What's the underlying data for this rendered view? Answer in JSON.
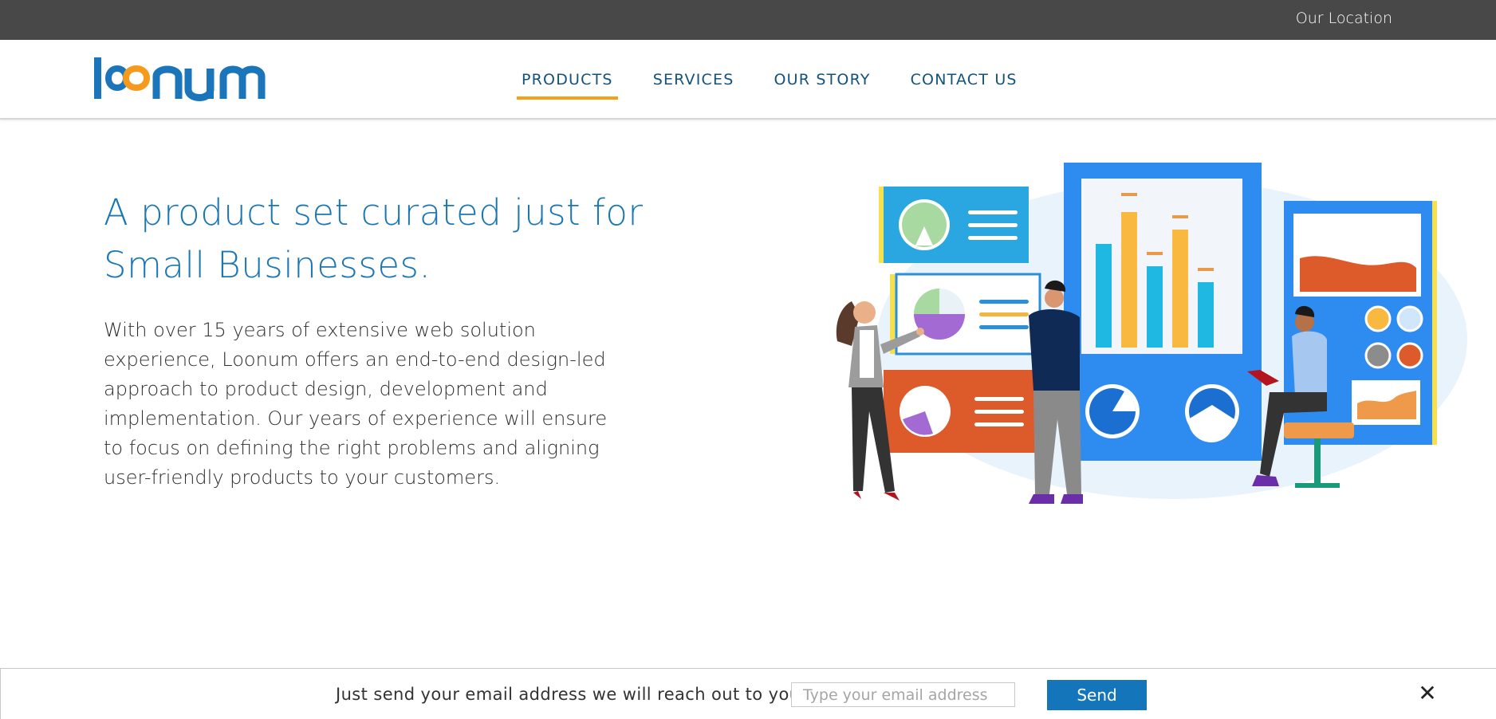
{
  "topbar": {
    "location_link": "Our Location"
  },
  "header": {
    "logo_text": "loonum",
    "nav": [
      {
        "label": "PRODUCTS",
        "active": true
      },
      {
        "label": "SERVICES",
        "active": false
      },
      {
        "label": "OUR STORY",
        "active": false
      },
      {
        "label": "CONTACT US",
        "active": false
      }
    ]
  },
  "hero": {
    "title_line1": "A product set curated just for",
    "title_line2": "Small Businesses.",
    "body": "With over 15 years of extensive web solution experience, Loonum offers an end-to-end design-led approach to product design, development and implementation. Our years of experience will ensure to focus on defining the right problems and aligning user-friendly products to your customers."
  },
  "footer": {
    "message": "Just send your email address we will reach out to you",
    "email_placeholder": "Type your email address",
    "email_value": "",
    "send_label": "Send",
    "close_symbol": "✕"
  },
  "colors": {
    "topbar": "#484848",
    "brand_blue": "#1575bb",
    "accent_orange": "#f2a21a",
    "nav_text": "#13527a",
    "hero_title": "#1b77b4"
  },
  "icons": [
    "loonum-logo",
    "close-icon",
    "business-presentation-illustration"
  ]
}
